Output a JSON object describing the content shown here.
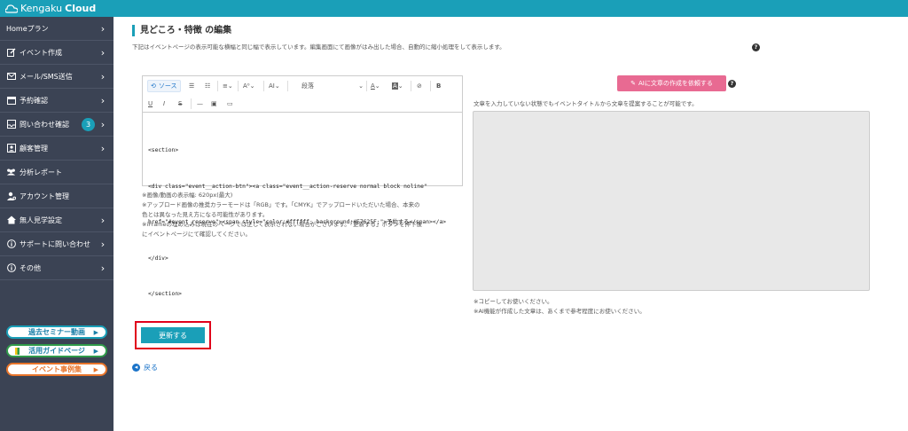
{
  "app": {
    "logo_prefix": "Kengaku",
    "logo_suffix": "Cloud"
  },
  "sidebar": {
    "items": [
      {
        "label": "Homeプラン",
        "icon": "none"
      },
      {
        "label": "イベント作成",
        "icon": "edit-icon"
      },
      {
        "label": "メール/SMS送信",
        "icon": "mail-icon"
      },
      {
        "label": "予約確認",
        "icon": "calendar-icon"
      },
      {
        "label": "問い合わせ確認",
        "icon": "inbox-icon",
        "badge": "3"
      },
      {
        "label": "顧客管理",
        "icon": "contacts-icon"
      },
      {
        "label": "分析レポート",
        "icon": "users-icon"
      },
      {
        "label": "アカウント管理",
        "icon": "user-gear-icon"
      },
      {
        "label": "無人見学設定",
        "icon": "home-icon"
      },
      {
        "label": "サポートに問い合わせ",
        "icon": "info-icon"
      },
      {
        "label": "その他",
        "icon": "info-icon"
      }
    ],
    "pills": [
      {
        "label": "過去セミナー動画"
      },
      {
        "label": "活用ガイドページ"
      },
      {
        "label": "イベント事例集"
      }
    ]
  },
  "main": {
    "title": "見どころ・特徴 の編集",
    "description": "下記はイベントページの表示可能な横幅と同じ幅で表示しています。編集画面にて画像がはみ出した場合、自動的に縮小処理をして表示します。"
  },
  "editor": {
    "toolbar": {
      "source_label": "ソース",
      "format_label": "段落"
    },
    "code_lines": [
      "<section>",
      "<div class=\"event__action-btn\"><a class=\"event__action-reserve normal block noline\"",
      "href=\"#event_reserve\"><span style=\"color:#ffffff; background:#E7625F;\">予約する</span></a>",
      "</div>",
      "</section>"
    ]
  },
  "notes": [
    "※画像/動画の表示幅: 620px(最大)",
    "※アップロード画像の推奨カラーモードは「RGB」です。「CMYK」でアップロードいただいた場合、本来の",
    "色とは異なった見え方になる可能性があります。",
    "※iFrameの埋め込みは現在のページでは正しく表示されない場合がございます。「更新する」ボタンを押下後",
    "にイベントページにて確認してください。"
  ],
  "ai": {
    "button_label": "AIに文章の作成を依頼する",
    "description": "文章を入力していない状態でもイベントタイトルから文章を提案することが可能です。",
    "notes": [
      "※コピーしてお使いください。",
      "※AI機能が作成した文章は、あくまで参考程度にお使いください。"
    ]
  },
  "actions": {
    "update_label": "更新する",
    "back_label": "戻る"
  },
  "colors": {
    "accent": "#1a9fb8",
    "sidebar": "#3b4354",
    "ai_button": "#e86a92",
    "highlight": "#e0001b"
  }
}
